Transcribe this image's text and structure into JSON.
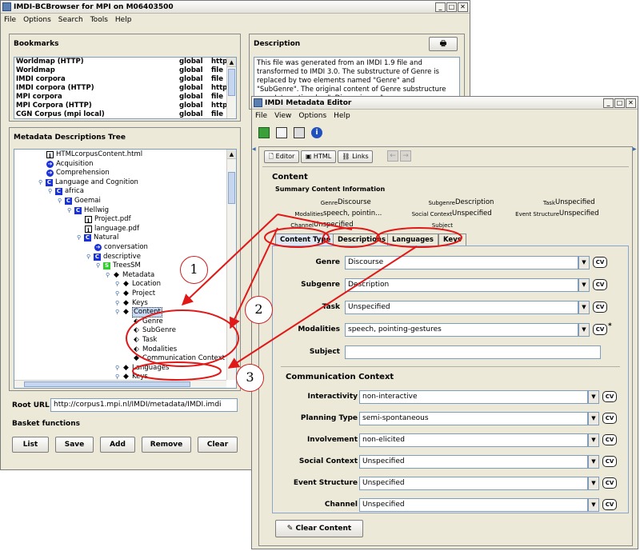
{
  "browser": {
    "title": "IMDI-BCBrowser for MPI on M06403500",
    "menu": [
      "File",
      "Options",
      "Search",
      "Tools",
      "Help"
    ],
    "bookmarks_title": "Bookmarks",
    "bookmarks": [
      {
        "name": "Worldmap (HTTP)",
        "scope": "global",
        "proto": "http"
      },
      {
        "name": "Worldmap",
        "scope": "global",
        "proto": "file"
      },
      {
        "name": "IMDI corpora",
        "scope": "global",
        "proto": "file"
      },
      {
        "name": "IMDI corpora (HTTP)",
        "scope": "global",
        "proto": "http"
      },
      {
        "name": "MPI corpora",
        "scope": "global",
        "proto": "file"
      },
      {
        "name": "MPI Corpora (HTTP)",
        "scope": "global",
        "proto": "http"
      },
      {
        "name": "CGN Corpus (mpi local)",
        "scope": "global",
        "proto": "file"
      }
    ],
    "description_title": "Description",
    "description_text": "This file was generated from an IMDI 1.9 file and transformed to IMDI 3.0. The substructure of Genre is replaced by two elements named \"Genre\" and \"SubGenre\". The original content of Genre substructure was: Interactional = \". Discursive = \".",
    "tree_title": "Metadata Descriptions Tree",
    "tree": [
      {
        "label": "HTMLcorpusContent.html",
        "icon": "info-icon",
        "indent": 0
      },
      {
        "label": "Acquisition",
        "icon": "arrow-icon",
        "indent": 0
      },
      {
        "label": "Comprehension",
        "icon": "arrow-icon",
        "indent": 0
      },
      {
        "label": "Language and Cognition",
        "icon": "corpus-icon",
        "indent": 0,
        "knob": true
      },
      {
        "label": "africa",
        "icon": "corpus-icon",
        "indent": 1,
        "knob": true
      },
      {
        "label": "Goemai",
        "icon": "corpus-icon",
        "indent": 2,
        "knob": true
      },
      {
        "label": "Hellwig",
        "icon": "corpus-icon",
        "indent": 3,
        "knob": true
      },
      {
        "label": "Project.pdf",
        "icon": "info-icon",
        "indent": 4
      },
      {
        "label": "language.pdf",
        "icon": "info-icon",
        "indent": 4
      },
      {
        "label": "Natural",
        "icon": "corpus-icon",
        "indent": 4,
        "knob": true
      },
      {
        "label": "conversation",
        "icon": "arrow-icon",
        "indent": 5
      },
      {
        "label": "descriptive",
        "icon": "corpus-icon",
        "indent": 5,
        "knob": true
      },
      {
        "label": "TreesSM",
        "icon": "session-icon",
        "indent": 6,
        "knob": true
      },
      {
        "label": "Metadata",
        "icon": "diamond-icon",
        "indent": 7,
        "knob": true
      },
      {
        "label": "Location",
        "icon": "diamond-icon",
        "indent": 8,
        "knob": true
      },
      {
        "label": "Project",
        "icon": "diamond-icon",
        "indent": 8,
        "knob": true
      },
      {
        "label": "Keys",
        "icon": "diamond-icon",
        "indent": 8,
        "knob": true
      },
      {
        "label": "Content",
        "icon": "diamond-icon",
        "indent": 8,
        "knob": true,
        "selected": true
      },
      {
        "label": "Genre",
        "icon": "field-icon",
        "indent": 9
      },
      {
        "label": "SubGenre",
        "icon": "field-icon",
        "indent": 9
      },
      {
        "label": "Task",
        "icon": "field-icon",
        "indent": 9
      },
      {
        "label": "Modalities",
        "icon": "field-icon",
        "indent": 9
      },
      {
        "label": "Communication Context",
        "icon": "diamond-icon",
        "indent": 9
      },
      {
        "label": "Languages",
        "icon": "diamond-icon",
        "indent": 8,
        "knob": true
      },
      {
        "label": "Keys",
        "icon": "diamond-icon",
        "indent": 8,
        "knob": true
      }
    ],
    "root_url_label": "Root URL",
    "root_url_value": "http://corpus1.mpi.nl/IMDI/metadata/IMDI.imdi",
    "basket_title": "Basket functions",
    "basket_buttons": [
      "List",
      "Save",
      "Add",
      "Remove",
      "Clear"
    ]
  },
  "editor": {
    "title": "IMDI Metadata Editor",
    "menu": [
      "File",
      "View",
      "Options",
      "Help"
    ],
    "view_tabs": [
      "Editor",
      "HTML",
      "Links"
    ],
    "section_title": "Content",
    "summary_title": "Summary Content Information",
    "summary": [
      {
        "key": "Genre",
        "value": "Discourse"
      },
      {
        "key": "Subgenre",
        "value": "Description"
      },
      {
        "key": "Task",
        "value": "Unspecified"
      },
      {
        "key": "Modalities",
        "value": "speech, pointin..."
      },
      {
        "key": "Social Context",
        "value": "Unspecified"
      },
      {
        "key": "Event Structure",
        "value": "Unspecified"
      },
      {
        "key": "Channel",
        "value": "Unspecified"
      },
      {
        "key": "Subject",
        "value": ""
      }
    ],
    "tabs": [
      "Content Type",
      "Descriptions",
      "Languages",
      "Keys"
    ],
    "fields": [
      {
        "label": "Genre",
        "value": "Discourse",
        "dropdown": true
      },
      {
        "label": "Subgenre",
        "value": "Description",
        "dropdown": true
      },
      {
        "label": "Task",
        "value": "Unspecified",
        "dropdown": true
      },
      {
        "label": "Modalities",
        "value": "speech, pointing-gestures",
        "dropdown": true,
        "star": "*"
      },
      {
        "label": "Subject",
        "value": "",
        "dropdown": false
      }
    ],
    "cv_label": "CV",
    "comm_title": "Communication Context",
    "comm_fields": [
      {
        "label": "Interactivity",
        "value": "non-interactive"
      },
      {
        "label": "Planning Type",
        "value": "semi-spontaneous"
      },
      {
        "label": "Involvement",
        "value": "non-elicited"
      },
      {
        "label": "Social Context",
        "value": "Unspecified"
      },
      {
        "label": "Event Structure",
        "value": "Unspecified"
      },
      {
        "label": "Channel",
        "value": "Unspecified"
      }
    ],
    "clear_button": "Clear Content"
  },
  "annotations": [
    "1",
    "2",
    "3"
  ],
  "colors": {
    "annotation": "#e01818",
    "tree_icon": "#1a31d8",
    "session_icon": "#2ad22a"
  }
}
